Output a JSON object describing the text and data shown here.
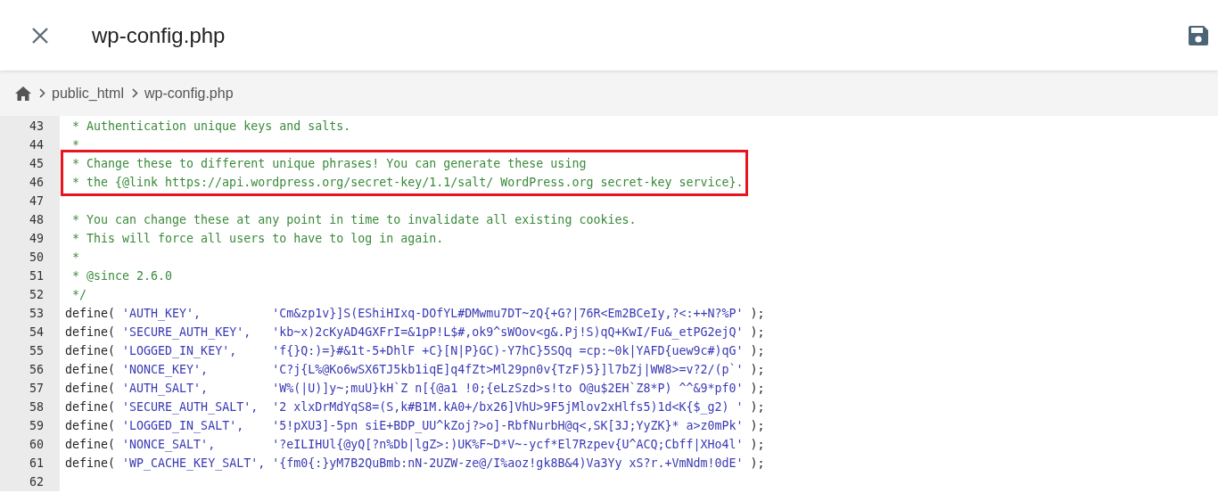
{
  "header": {
    "title": "wp-config.php"
  },
  "breadcrumb": [
    {
      "label": "public_html"
    },
    {
      "label": "wp-config.php"
    }
  ],
  "editor": {
    "lines": [
      {
        "number": "43",
        "kind": "comment",
        "text": " * Authentication unique keys and salts."
      },
      {
        "number": "44",
        "kind": "comment",
        "text": " *"
      },
      {
        "number": "45",
        "kind": "comment",
        "boxed": true,
        "text": " * Change these to different unique phrases! You can generate these using"
      },
      {
        "number": "46",
        "kind": "comment",
        "boxed": true,
        "text": " * the {@link https://api.wordpress.org/secret-key/1.1/salt/ WordPress.org secret-key service}."
      },
      {
        "number": "47",
        "kind": "blank"
      },
      {
        "number": "48",
        "kind": "comment",
        "text": " * You can change these at any point in time to invalidate all existing cookies."
      },
      {
        "number": "49",
        "kind": "comment",
        "text": " * This will force all users to have to log in again."
      },
      {
        "number": "50",
        "kind": "comment",
        "text": " *"
      },
      {
        "number": "51",
        "kind": "comment",
        "text": " * @since 2.6.0"
      },
      {
        "number": "52",
        "kind": "comment",
        "text": " */"
      },
      {
        "number": "53",
        "kind": "define",
        "call": "define(",
        "key": "'AUTH_KEY',",
        "value": "'Cm&zp1v}]S(EShiHIxq-DOfYL#DMwmu7DT~zQ{+G?|76R<Em2BCeIy,?<:++N?%P'",
        "end": ");"
      },
      {
        "number": "54",
        "kind": "define",
        "call": "define(",
        "key": "'SECURE_AUTH_KEY',",
        "value": "'kb~x)2cKyAD4GXFrI=&1pP!L$#,ok9^sWOov<g&.Pj!S)qQ+KwI/Fu&_etPG2ejQ'",
        "end": ");"
      },
      {
        "number": "55",
        "kind": "define",
        "call": "define(",
        "key": "'LOGGED_IN_KEY',",
        "value": "'f{}Q:)=}#&1t-5+DhlF +C}[N|P}GC)-Y7hC}5SQq =cp:~0k|YAFD{uew9c#)qG'",
        "end": ");"
      },
      {
        "number": "56",
        "kind": "define",
        "call": "define(",
        "key": "'NONCE_KEY',",
        "value": "'C?j{L%@Ko6wSX6TJ5kb1iqE]q4fZt>Ml29pn0v{TzF)5}]l7bZj|WW8>=v?2/(p`'",
        "end": ");"
      },
      {
        "number": "57",
        "kind": "define",
        "call": "define(",
        "key": "'AUTH_SALT',",
        "value": "'W%(|U)]y~;muU}kH`Z n[{@a1 !0;{eLzSzd>s!to O@u$2EH`Z8*P) ^^&9*pf0'",
        "end": ");"
      },
      {
        "number": "58",
        "kind": "define",
        "call": "define(",
        "key": "'SECURE_AUTH_SALT',",
        "value": "'2 xlxDrMdYqS8=(S,k#B1M.kA0+/bx26]VhU>9F5jMlov2xHlfs5)1d<K{$_g2) '",
        "end": ");"
      },
      {
        "number": "59",
        "kind": "define",
        "call": "define(",
        "key": "'LOGGED_IN_SALT',",
        "value": "'5!pXU3]-5pn siE+BDP_UU^kZoj?>o]-RbfNurbH@q<,SK[3J;YyZK}* a>z0mPk'",
        "end": ");"
      },
      {
        "number": "60",
        "kind": "define",
        "call": "define(",
        "key": "'NONCE_SALT',",
        "value": "'?eILIHUl{@yQ[?n%Db|lgZ>:)UK%F~D*V~-ycf*El7Rzpev{U^ACQ;Cbff|XHo4l'",
        "end": ");"
      },
      {
        "number": "61",
        "kind": "define",
        "call": "define(",
        "key": "'WP_CACHE_KEY_SALT',",
        "value": "'{fm0{:}yM7B2QuBmb:nN-2UZW-ze@/I%aoz!gk8B&4)Va3Yy xS?r.+VmNdm!0dE'",
        "end": ");"
      },
      {
        "number": "62",
        "kind": "blank"
      }
    ]
  }
}
